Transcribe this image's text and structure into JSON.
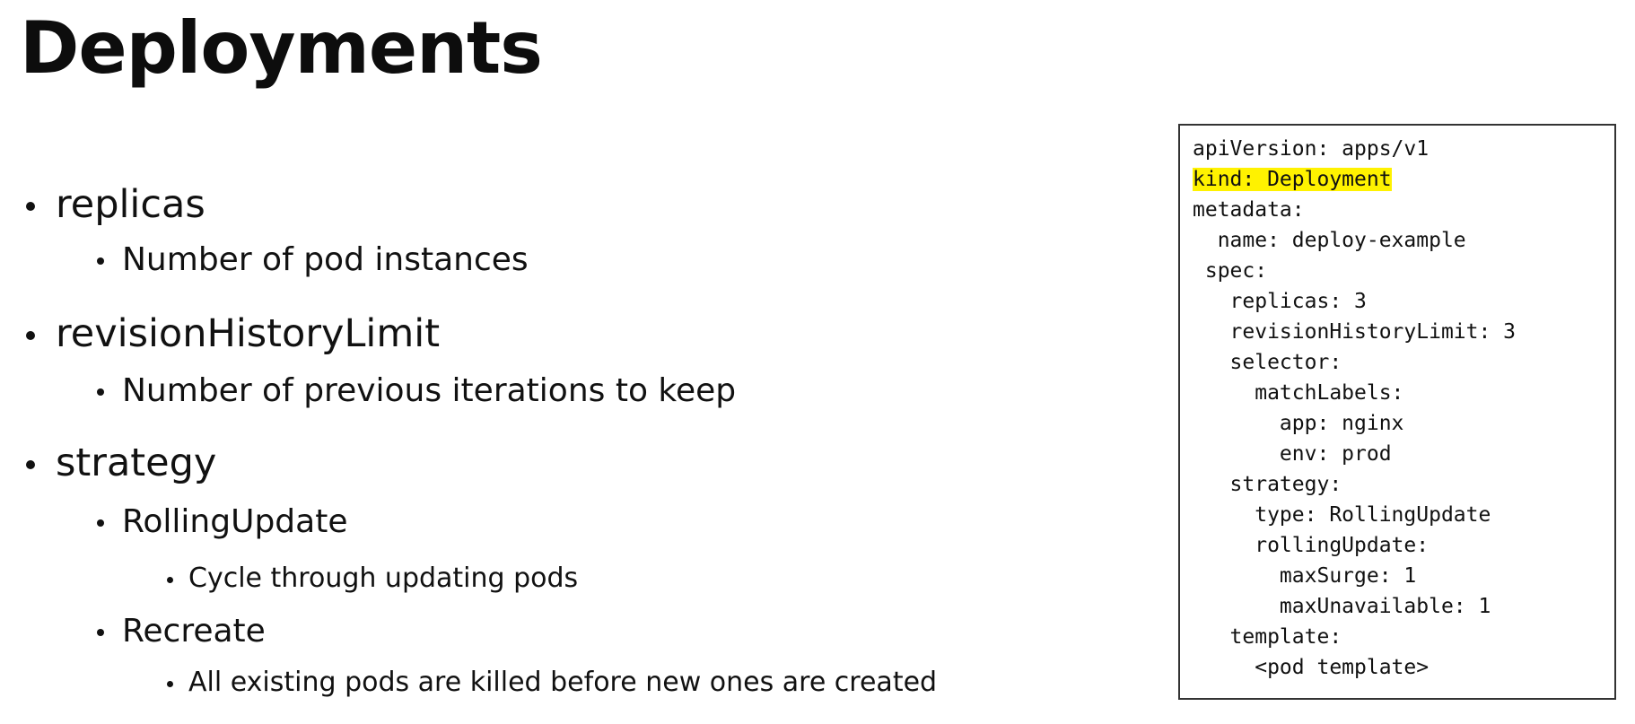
{
  "title": "Deployments",
  "bullets": [
    {
      "level": 1,
      "text": "replicas"
    },
    {
      "level": 2,
      "text": "Number of pod instances"
    },
    {
      "level": 1,
      "text": "revisionHistoryLimit"
    },
    {
      "level": 2,
      "text": "Number of previous iterations to keep"
    },
    {
      "level": 1,
      "text": "strategy"
    },
    {
      "level": 2,
      "text": "RollingUpdate"
    },
    {
      "level": 3,
      "text": "Cycle through updating pods"
    },
    {
      "level": 2,
      "text": "Recreate"
    },
    {
      "level": 3,
      "text": "All existing pods are killed before new ones are created"
    }
  ],
  "code": {
    "lines": [
      "apiVersion: apps/v1",
      "kind: Deployment",
      "metadata:",
      "  name: deploy-example",
      " spec:",
      "   replicas: 3",
      "   revisionHistoryLimit: 3",
      "   selector:",
      "     matchLabels:",
      "       app: nginx",
      "       env: prod",
      "   strategy:",
      "     type: RollingUpdate",
      "     rollingUpdate:",
      "       maxSurge: 1",
      "       maxUnavailable: 1",
      "   template:",
      "     <pod template>"
    ],
    "highlighted_line_index": 1,
    "highlight_color": "#fff200"
  }
}
